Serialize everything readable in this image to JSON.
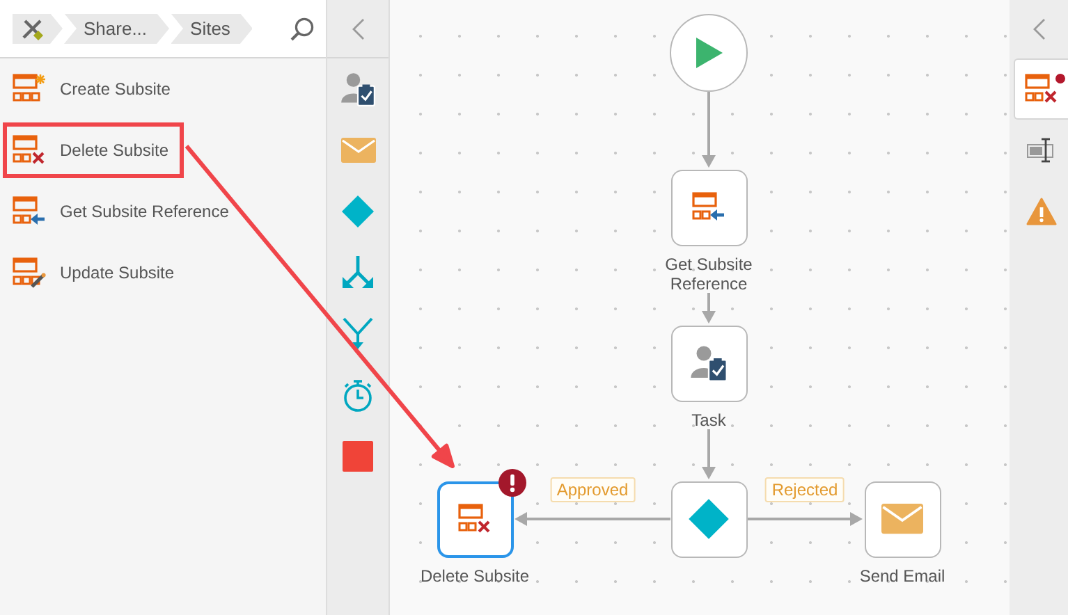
{
  "breadcrumb": [
    {
      "kind": "home"
    },
    {
      "kind": "crumb",
      "label": "Share..."
    },
    {
      "kind": "crumb",
      "label": "Sites"
    }
  ],
  "actions": [
    {
      "kind": "create",
      "label": "Create Subsite",
      "highlighted": false
    },
    {
      "kind": "delete",
      "label": "Delete Subsite",
      "highlighted": true
    },
    {
      "kind": "get",
      "label": "Get Subsite Reference",
      "highlighted": false
    },
    {
      "kind": "update",
      "label": "Update Subsite",
      "highlighted": false
    }
  ],
  "toolbox": [
    {
      "kind": "task"
    },
    {
      "kind": "email"
    },
    {
      "kind": "condition"
    },
    {
      "kind": "split"
    },
    {
      "kind": "merge"
    },
    {
      "kind": "timer"
    },
    {
      "kind": "stop"
    }
  ],
  "canvas": {
    "nodes": [
      {
        "kind": "start",
        "selected": false,
        "error": false
      },
      {
        "kind": "get",
        "label": "Get Subsite Reference",
        "selected": false,
        "error": false
      },
      {
        "kind": "task",
        "label": "Task",
        "selected": false,
        "error": false
      },
      {
        "kind": "condition",
        "selected": false,
        "error": false
      },
      {
        "kind": "delete",
        "label": "Delete Subsite",
        "selected": true,
        "error": true
      },
      {
        "kind": "email",
        "label": "Send Email",
        "selected": false,
        "error": false
      }
    ],
    "connectors": [
      {
        "kind": "flow"
      },
      {
        "kind": "flow"
      },
      {
        "kind": "flow"
      },
      {
        "kind": "branch",
        "label": "Approved"
      },
      {
        "kind": "branch",
        "label": "Rejected"
      }
    ]
  },
  "properties_rail": [
    {
      "kind": "delete",
      "selected": true,
      "alert": true
    },
    {
      "kind": "properties",
      "selected": false,
      "alert": false
    },
    {
      "kind": "warnings",
      "selected": false,
      "alert": false
    }
  ]
}
